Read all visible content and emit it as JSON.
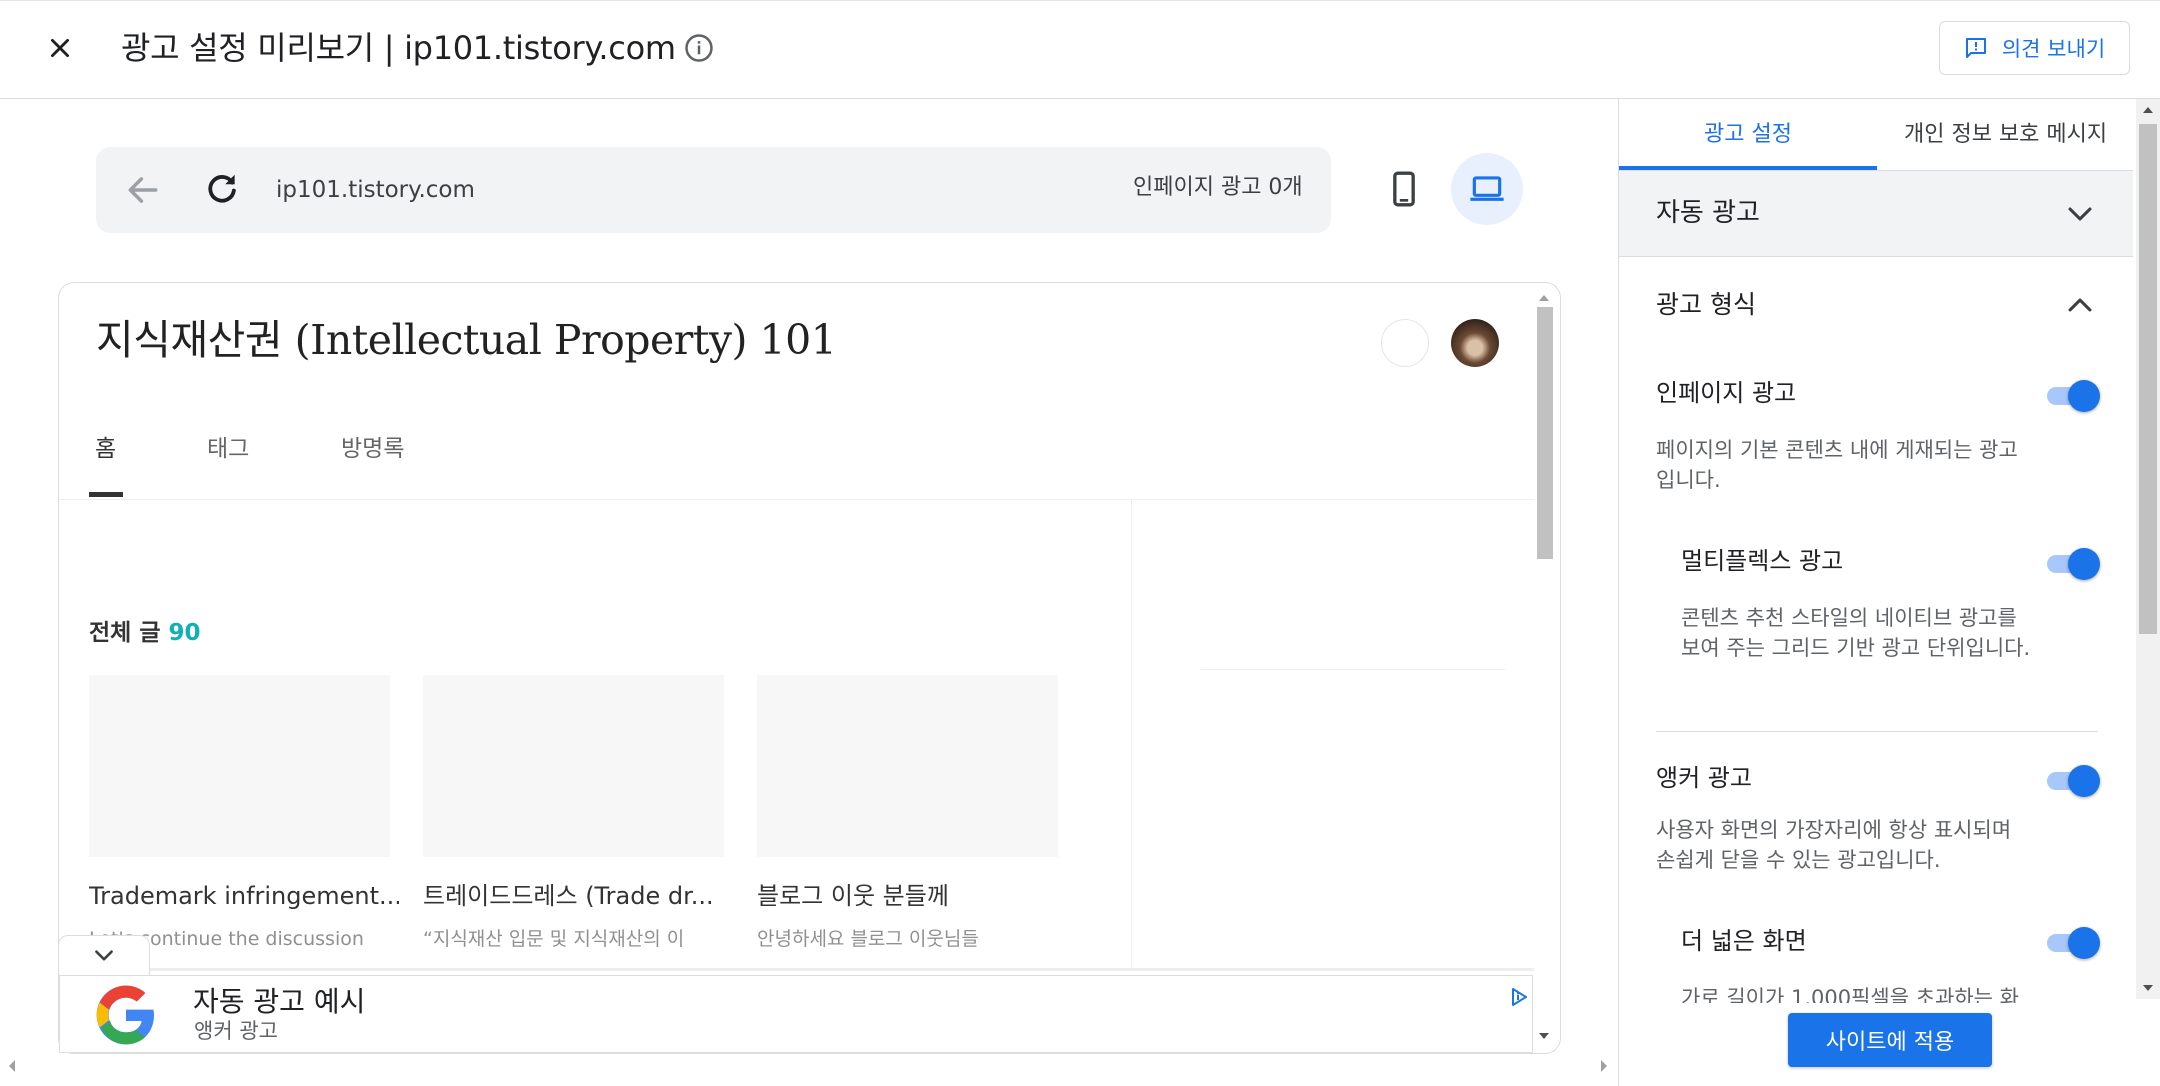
{
  "header": {
    "title": "광고 설정 미리보기 | ip101.tistory.com",
    "feedback_label": "의견 보내기"
  },
  "preview": {
    "url": "ip101.tistory.com",
    "inpage_ad_count": "인페이지 광고 0개"
  },
  "blog": {
    "title": "지식재산권 (Intellectual Property) 101",
    "tabs": [
      "홈",
      "태그",
      "방명록"
    ],
    "posts_heading": "전체 글",
    "posts_count": "90",
    "posts": [
      {
        "title": "Trademark infringement...",
        "excerpt": "Let's continue the discussion"
      },
      {
        "title": "트레이드드레스 (Trade dr...",
        "excerpt": "“지식재산 입문 및 지식재산의 이"
      },
      {
        "title": "블로그 이웃 분들께",
        "excerpt": "안녕하세요 블로그 이웃님들"
      }
    ]
  },
  "anchor_ad": {
    "title": "자동 광고 예시",
    "subtitle": "앵커 광고"
  },
  "panel": {
    "tabs": [
      "광고 설정",
      "개인 정보 보호 메시지"
    ],
    "auto_ads_label": "자동 광고",
    "ad_format_label": "광고 형식",
    "settings": [
      {
        "title": "인페이지 광고",
        "desc": "페이지의 기본 콘텐츠 내에 게재되는 광고입니다.",
        "enabled": true
      },
      {
        "title": "멀티플렉스 광고",
        "desc": "콘텐츠 추천 스타일의 네이티브 광고를 보여 주는 그리드 기반 광고 단위입니다.",
        "enabled": true
      },
      {
        "title": "앵커 광고",
        "desc": "사용자 화면의 가장자리에 항상 표시되며 손쉽게 닫을 수 있는 광고입니다.",
        "enabled": true
      },
      {
        "title": "더 넓은 화면",
        "desc": "가로 길이가 1,000픽셀을 초과하는 화",
        "enabled": true
      }
    ],
    "apply_label": "사이트에 적용"
  },
  "colors": {
    "accent": "#1a73e8",
    "toggle_track": "#a8c7fa",
    "post_count": "#10b0b5"
  }
}
